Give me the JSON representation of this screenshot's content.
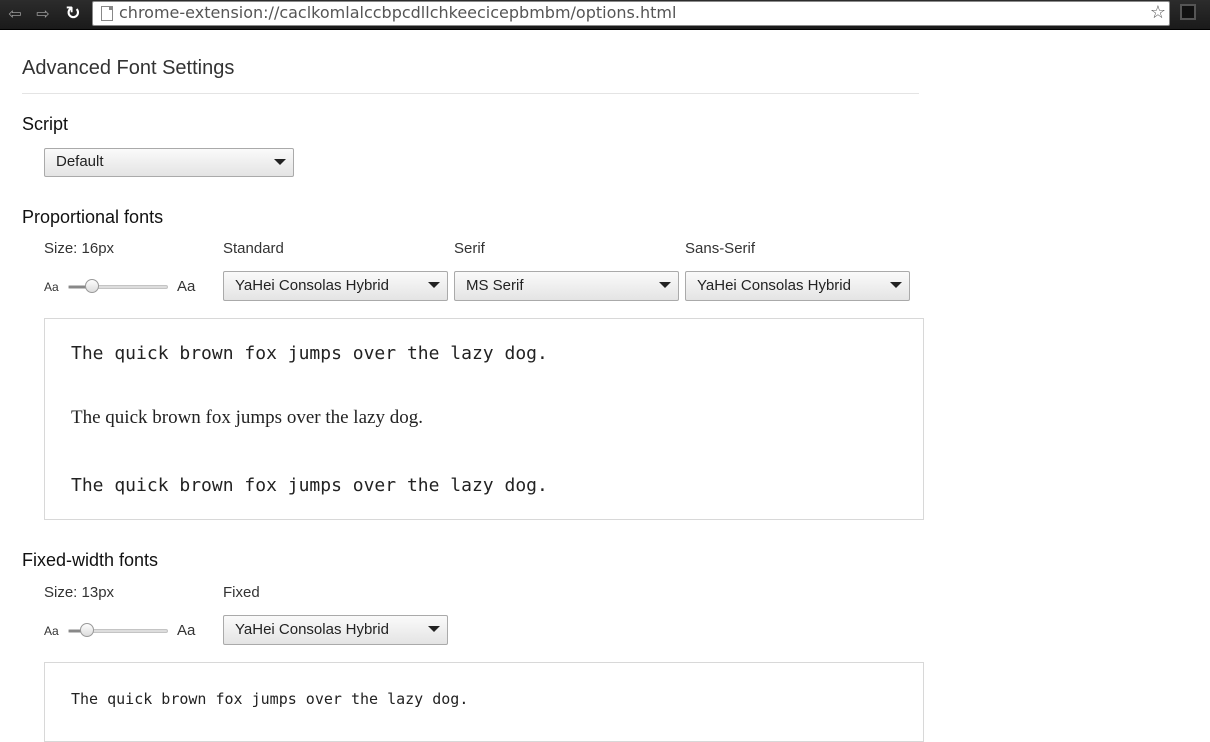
{
  "browser": {
    "url": "chrome-extension://caclkomlalccbpcdllchkeecicepbmbm/options.html",
    "back_icon": "back-arrow-icon",
    "forward_icon": "forward-arrow-icon",
    "reload_icon": "reload-icon",
    "bookmark_icon": "star-icon"
  },
  "page": {
    "title": "Advanced Font Settings"
  },
  "script": {
    "heading": "Script",
    "selected": "Default"
  },
  "proportional": {
    "heading": "Proportional fonts",
    "size_label": "Size: 16px",
    "size_slider": {
      "aa_small": "Aa",
      "aa_big": "Aa",
      "level_fraction": 0.25
    },
    "standard": {
      "label": "Standard",
      "selected": "YaHei Consolas Hybrid"
    },
    "serif": {
      "label": "Serif",
      "selected": "MS Serif"
    },
    "sans_serif": {
      "label": "Sans-Serif",
      "selected": "YaHei Consolas Hybrid"
    },
    "samples": [
      "The quick brown fox jumps over the lazy dog.",
      "The quick brown fox jumps over the lazy dog.",
      "The quick brown fox jumps over the lazy dog."
    ]
  },
  "fixed": {
    "heading": "Fixed-width fonts",
    "size_label": "Size: 13px",
    "size_slider": {
      "aa_small": "Aa",
      "aa_big": "Aa",
      "level_fraction": 0.19
    },
    "fixed": {
      "label": "Fixed",
      "selected": "YaHei Consolas Hybrid"
    },
    "sample": "The quick brown fox jumps over the lazy dog."
  }
}
